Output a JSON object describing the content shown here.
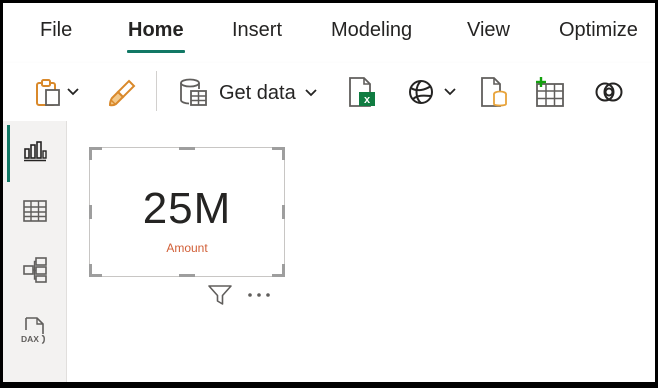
{
  "menu": {
    "tabs": [
      {
        "label": "File"
      },
      {
        "label": "Home"
      },
      {
        "label": "Insert"
      },
      {
        "label": "Modeling"
      },
      {
        "label": "View"
      },
      {
        "label": "Optimize"
      }
    ],
    "active_tab": "Home"
  },
  "ribbon": {
    "get_data_label": "Get data",
    "icons": [
      "clipboard-icon",
      "format-painter-icon",
      "database-table-icon",
      "excel-icon",
      "dataverse-icon",
      "sql-server-icon",
      "enter-data-icon",
      "recent-sources-icon"
    ]
  },
  "rail": {
    "items": [
      "report-view-icon",
      "table-view-icon",
      "model-view-icon",
      "dax-query-icon"
    ],
    "dax_label": "DAX"
  },
  "card": {
    "value": "25M",
    "label": "Amount"
  },
  "colors": {
    "accent": "#117865",
    "card_label": "#d15e36",
    "excel_green": "#107c41",
    "add_green": "#13a10e",
    "sql_orange": "#e8a33a"
  }
}
